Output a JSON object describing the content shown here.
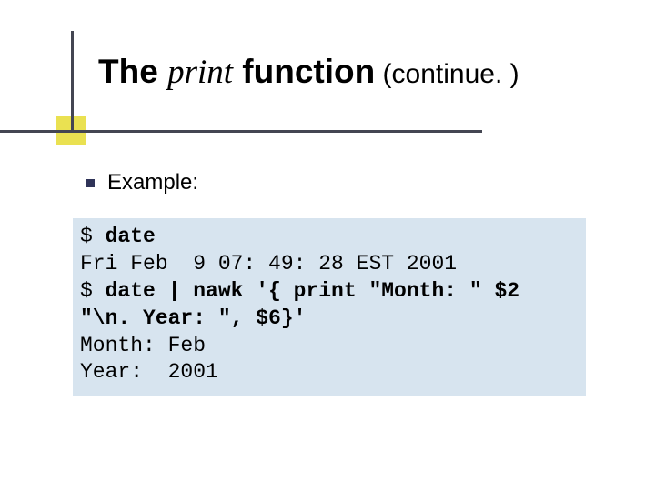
{
  "title": {
    "part1": "The ",
    "italic": "print",
    "part2": " function",
    "suffix": " (continue. )"
  },
  "bullet_label": "Example:",
  "code": {
    "l1a": "$ ",
    "l1b": "date",
    "l2": "Fri Feb  9 07: 49: 28 EST 2001",
    "l3a": "$ ",
    "l3b": "date | nawk '{ print \"Month: \" $2",
    "l4": "\"\\n. Year: \", $6}'",
    "l5": "Month: Feb",
    "l6": "Year:  2001"
  }
}
